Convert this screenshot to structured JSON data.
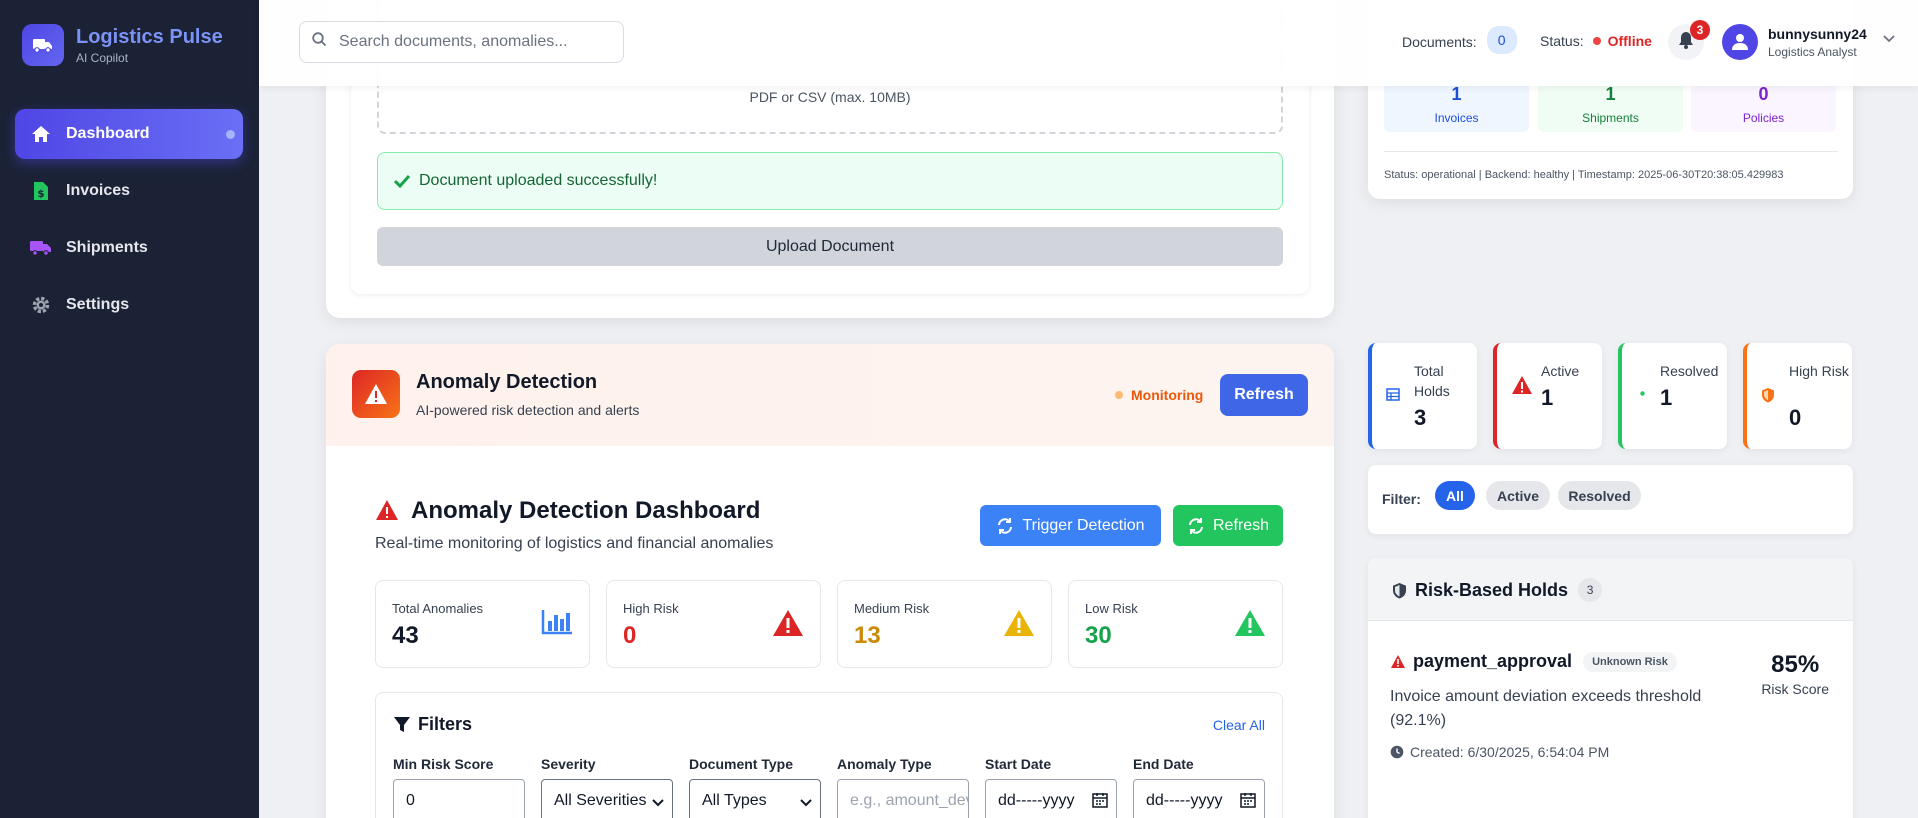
{
  "app": {
    "title": "Logistics Pulse",
    "subtitle": "AI Copilot"
  },
  "sidebar": {
    "items": [
      {
        "label": "Dashboard",
        "icon": "home-icon",
        "active": true
      },
      {
        "label": "Invoices",
        "icon": "invoice-icon",
        "active": false
      },
      {
        "label": "Shipments",
        "icon": "truck-icon",
        "active": false
      },
      {
        "label": "Settings",
        "icon": "gear-icon",
        "active": false
      }
    ]
  },
  "header": {
    "search_placeholder": "Search documents, anomalies...",
    "documents_label": "Documents:",
    "documents_count": "0",
    "status_label": "Status:",
    "status_value": "Offline",
    "notifications_count": "3",
    "user_name": "bunnysunny24",
    "user_role": "Logistics Analyst"
  },
  "upload": {
    "hint": "PDF or CSV (max. 10MB)",
    "success_message": "Document uploaded successfully!",
    "button_label": "Upload Document"
  },
  "doc_stats": {
    "tiles": [
      {
        "value": "1",
        "label": "Invoices",
        "color": "#1d4ed8",
        "bg": "#eff6ff"
      },
      {
        "value": "1",
        "label": "Shipments",
        "color": "#15803d",
        "bg": "#f0fdf4"
      },
      {
        "value": "0",
        "label": "Policies",
        "color": "#7e22ce",
        "bg": "#faf5ff"
      }
    ],
    "footer": "Status: operational | Backend: healthy | Timestamp: 2025-06-30T20:38:05.429983"
  },
  "anomaly_section": {
    "title": "Anomaly Detection",
    "subtitle": "AI-powered risk detection and alerts",
    "monitoring_label": "Monitoring",
    "refresh_label": "Refresh"
  },
  "dashboard": {
    "title": "Anomaly Detection Dashboard",
    "subtitle": "Real-time monitoring of logistics and financial anomalies",
    "trigger_label": "Trigger Detection",
    "refresh_label": "Refresh",
    "stats": [
      {
        "label": "Total Anomalies",
        "value": "43",
        "color": "#111827",
        "icon": "bar-chart-icon"
      },
      {
        "label": "High Risk",
        "value": "0",
        "color": "#dc2626",
        "icon": "warning-red-icon"
      },
      {
        "label": "Medium Risk",
        "value": "13",
        "color": "#ca8a04",
        "icon": "warning-yellow-icon"
      },
      {
        "label": "Low Risk",
        "value": "30",
        "color": "#16a34a",
        "icon": "warning-green-icon"
      }
    ]
  },
  "filters": {
    "title": "Filters",
    "clear_label": "Clear All",
    "fields": [
      {
        "label": "Min Risk Score",
        "value": "0"
      },
      {
        "label": "Severity",
        "value": "All Severities"
      },
      {
        "label": "Document Type",
        "value": "All Types"
      },
      {
        "label": "Anomaly Type",
        "placeholder": "e.g., amount_deviation"
      },
      {
        "label": "Start Date",
        "value": "dd-----yyyy"
      },
      {
        "label": "End Date",
        "value": "dd-----yyyy"
      }
    ]
  },
  "hold_stats": [
    {
      "label": "Total Holds",
      "value": "3",
      "color": "#2563eb",
      "icon": "table-icon"
    },
    {
      "label": "Active",
      "value": "1",
      "color": "#dc2626",
      "icon": "warning-icon"
    },
    {
      "label": "Resolved",
      "value": "1",
      "color": "#22c55e",
      "icon": "check-dot-icon"
    },
    {
      "label": "High Risk",
      "value": "0",
      "color": "#f97316",
      "icon": "shield-icon"
    }
  ],
  "hold_filter": {
    "label": "Filter:",
    "options": [
      "All",
      "Active",
      "Resolved"
    ],
    "selected": "All"
  },
  "holds": {
    "title": "Risk-Based Holds",
    "count": "3",
    "items": [
      {
        "name": "payment_approval",
        "risk_tag": "Unknown Risk",
        "description": "Invoice amount deviation exceeds threshold (92.1%)",
        "created": "Created: 6/30/2025, 6:54:04 PM",
        "score": "85%",
        "score_label": "Risk Score"
      }
    ]
  }
}
